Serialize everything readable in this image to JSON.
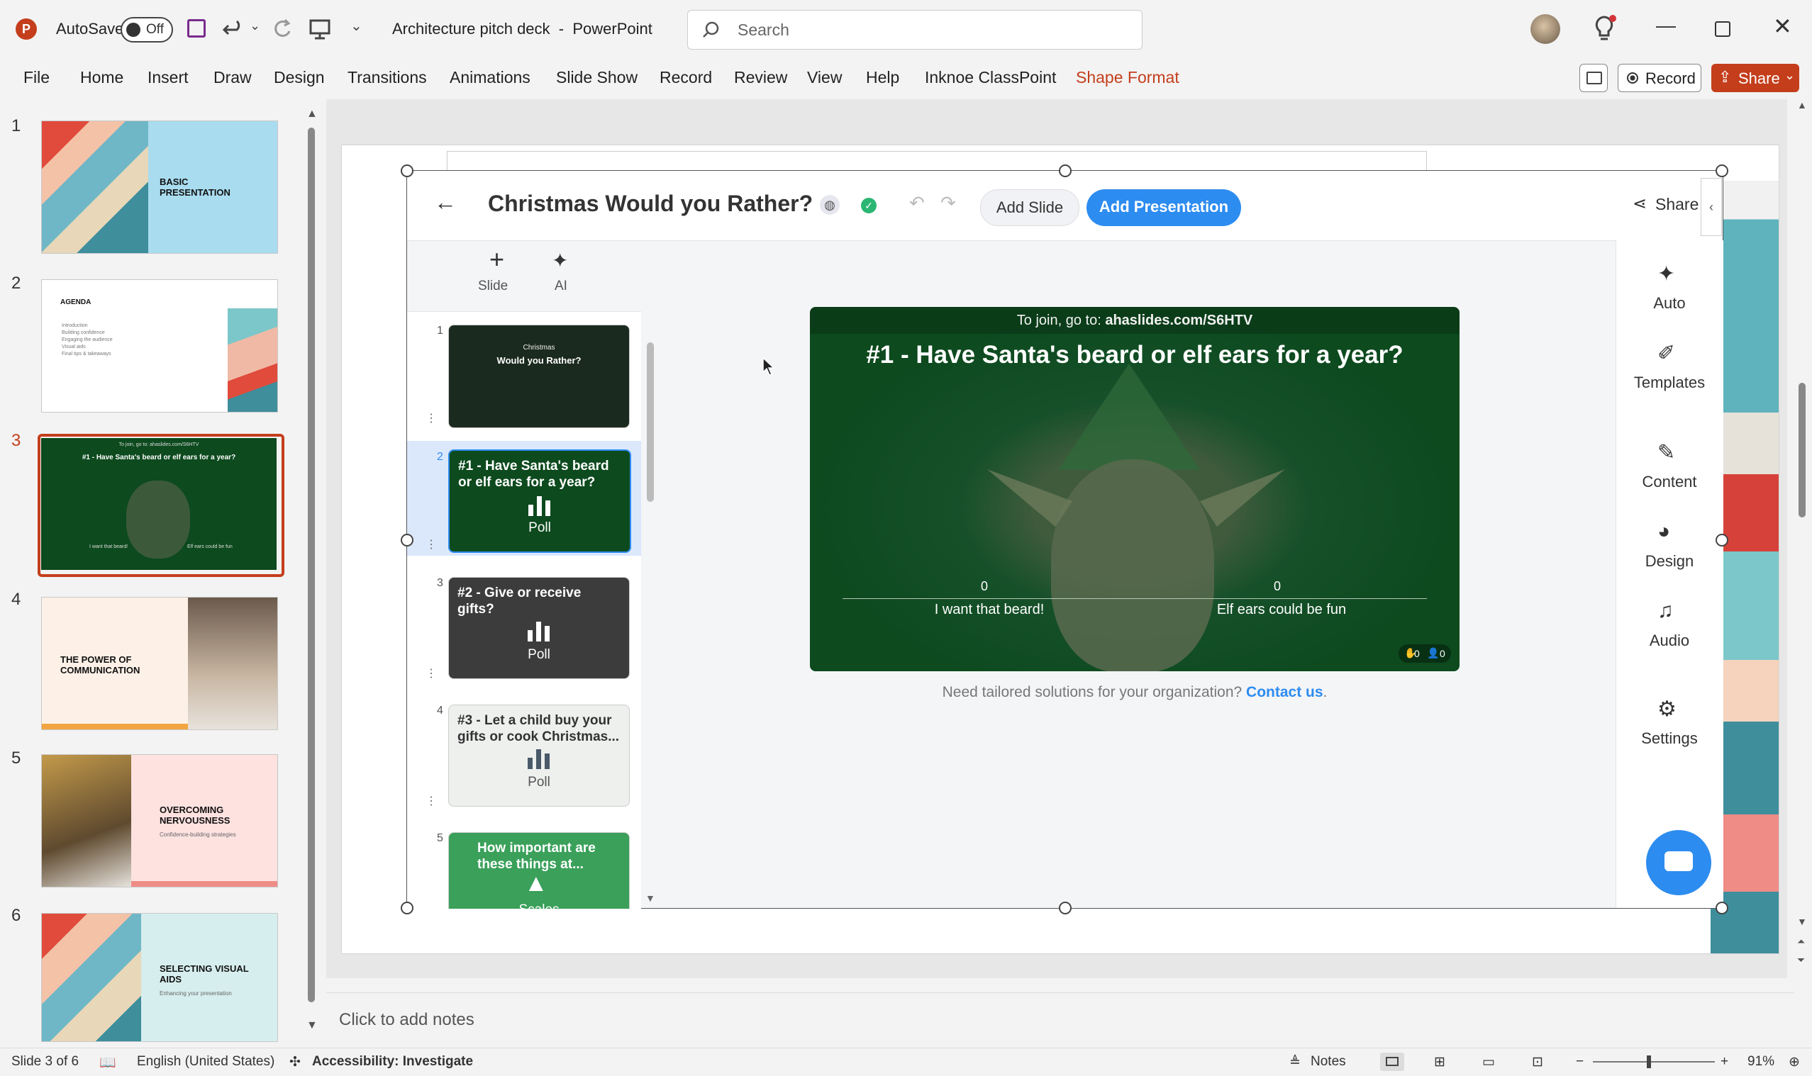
{
  "app": {
    "autosave_label": "AutoSave",
    "autosave_state": "Off",
    "doc_title": "Architecture pitch deck",
    "separator": "-",
    "app_name": "PowerPoint",
    "search_placeholder": "Search"
  },
  "menu": [
    "File",
    "Home",
    "Insert",
    "Draw",
    "Design",
    "Transitions",
    "Animations",
    "Slide Show",
    "Record",
    "Review",
    "View",
    "Help",
    "Inknoe ClassPoint",
    "Shape Format"
  ],
  "ribbon_right": {
    "record_label": "Record",
    "share_label": "Share"
  },
  "thumbnails": [
    {
      "num": "1",
      "title": "BASIC PRESENTATION",
      "subtitle": ""
    },
    {
      "num": "2",
      "title": "AGENDA",
      "items": [
        "Introduction",
        "Building confidence",
        "Engaging the audience",
        "Visual aids",
        "Final tips & takeaways"
      ]
    },
    {
      "num": "3",
      "title": "#1 - Have Santa's beard or elf ears for a year?",
      "join": "To join, go to: ahaslides.com/S6HTV",
      "left": "I want that beard!",
      "right": "Elf ears could be fun"
    },
    {
      "num": "4",
      "title": "THE POWER OF COMMUNICATION"
    },
    {
      "num": "5",
      "title": "OVERCOMING NERVOUSNESS",
      "subtitle": "Confidence-building strategies"
    },
    {
      "num": "6",
      "title": "SELECTING VISUAL AIDS",
      "subtitle": "Enhancing your presentation"
    }
  ],
  "embed": {
    "title": "Christmas Would you Rather?",
    "add_slide": "Add Slide",
    "add_presentation": "Add Presentation",
    "share": "Share",
    "left_tools": {
      "slide": "Slide",
      "ai": "AI"
    },
    "mini_slides": [
      {
        "num": "1",
        "line1": "Christmas",
        "line2": "Would you Rather?"
      },
      {
        "num": "2",
        "label": "#1 - Have Santa's beard or elf ears for a year?",
        "type": "Poll"
      },
      {
        "num": "3",
        "label": "#2 - Give or receive gifts?",
        "type": "Poll"
      },
      {
        "num": "4",
        "label": "#3 - Let a child buy your gifts or cook Christmas...",
        "type": "Poll"
      },
      {
        "num": "5",
        "label": "How important are these things at...",
        "type": "Scales"
      }
    ],
    "main_slide": {
      "join_prefix": "To join, go to: ",
      "join_url": "ahaslides.com/S6HTV",
      "question": "#1 - Have Santa's beard or elf ears for a year?",
      "option_left": "I want that beard!",
      "option_right": "Elf ears could be fun",
      "count_left": "0",
      "count_right": "0",
      "reactions": "0",
      "participants": "0"
    },
    "footer_text": "Need tailored solutions for your organization?",
    "footer_link": "Contact us",
    "footer_end": ".",
    "right_tools": [
      "Auto",
      "Templates",
      "Content",
      "Design",
      "Audio",
      "Settings"
    ]
  },
  "notes_placeholder": "Click to add notes",
  "status": {
    "slide_info": "Slide 3 of 6",
    "language": "English (United States)",
    "accessibility": "Accessibility: Investigate",
    "notes": "Notes",
    "zoom": "91%"
  },
  "colors": {
    "accent": "#c43e1c",
    "ahaslides_blue": "#2d8cf0",
    "slide_green": "#0d4a1e"
  }
}
